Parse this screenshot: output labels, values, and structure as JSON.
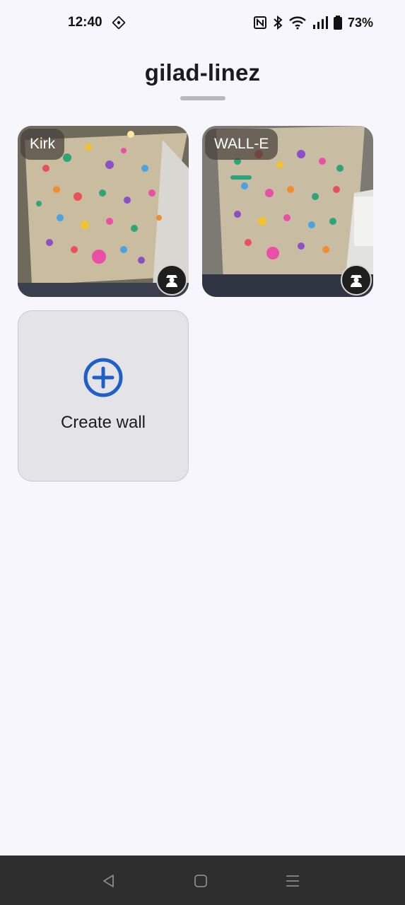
{
  "status_bar": {
    "time": "12:40",
    "battery": "73%",
    "icons": [
      "sync-icon",
      "nfc-icon",
      "bluetooth-icon",
      "wifi-icon",
      "signal-icon",
      "battery-icon"
    ]
  },
  "header": {
    "title": "gilad-linez"
  },
  "walls": [
    {
      "name": "Kirk",
      "badge_icon": "owner-icon"
    },
    {
      "name": "WALL-E",
      "badge_icon": "owner-icon"
    }
  ],
  "create_wall": {
    "label": "Create wall",
    "icon": "add-circle-icon",
    "accent": "#1f5fc7"
  },
  "nav_bar": {
    "items": [
      "back-icon",
      "home-icon",
      "menu-icon"
    ]
  }
}
